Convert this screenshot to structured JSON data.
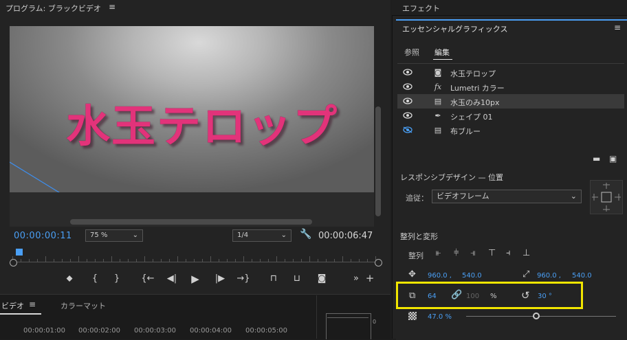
{
  "program_monitor": {
    "title": "プログラム: ブラックビデオ",
    "menu_icon": "hamburger-icon",
    "telop_text": "水玉テロップ",
    "current_timecode": "00:00:00:11",
    "zoom": "75 %",
    "resolution": "1/4",
    "duration_timecode": "00:00:06:47",
    "wrench_icon": "wrench-icon"
  },
  "sequence_panel": {
    "tab_label": "ビデオ",
    "other_tab": "カラーマット",
    "time_labels": [
      "00:00:01:00",
      "00:00:02:00",
      "00:00:03:00",
      "00:00:04:00",
      "00:00:05:00"
    ],
    "meter_label": "0"
  },
  "effects_bar": {
    "title": "エフェクト"
  },
  "essential_graphics": {
    "title": "エッセンシャルグラフィックス",
    "tabs": [
      "参照",
      "編集"
    ],
    "active_tab": "編集",
    "layers": [
      {
        "label": "水玉テロップ",
        "icon": "text-layer-icon",
        "visible": true,
        "selected": false
      },
      {
        "label": "Lumetri カラー",
        "icon": "fx-icon",
        "visible": true,
        "selected": false
      },
      {
        "label": "水玉のみ10px",
        "icon": "clip-icon",
        "visible": true,
        "selected": true
      },
      {
        "label": "シェイプ 01",
        "icon": "pen-icon",
        "visible": true,
        "selected": false
      },
      {
        "label": "布ブルー",
        "icon": "clip-icon",
        "visible": false,
        "selected": false
      }
    ],
    "responsive_design_title": "レスポンシブデザイン — 位置",
    "follow_label": "追従：",
    "follow_value": "ビデオフレーム",
    "align_transform_title": "整列と変形",
    "align_label": "整列",
    "position_x": "960.0 ,",
    "position_y": "540.0",
    "anchor_x": "960.0 ,",
    "anchor_y": "540.0",
    "scale_value": "64",
    "scale_height_value": "100",
    "percent_label": "%",
    "rotation_value": "30 °",
    "opacity_value": "47.0 %",
    "opacity_fraction": 0.47,
    "highlight_color": "#f2e600",
    "accent_color": "#4a9ff5"
  }
}
